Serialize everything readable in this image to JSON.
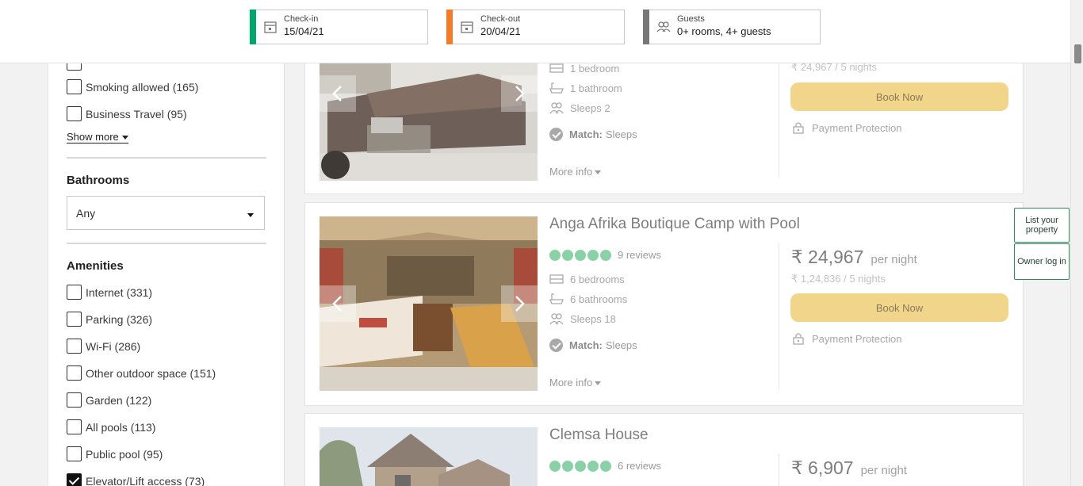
{
  "search": {
    "checkin": {
      "label": "Check-in",
      "value": "15/04/21",
      "accent": "#00a66a"
    },
    "checkout": {
      "label": "Check-out",
      "value": "20/04/21",
      "accent": "#f57c26"
    },
    "guests": {
      "label": "Guests",
      "value": "0+ rooms, 4+ guests",
      "accent": "#777777"
    }
  },
  "filters": {
    "top_items": [
      {
        "label": "Smoking allowed (165)",
        "checked": false
      },
      {
        "label": "Business Travel (95)",
        "checked": false
      }
    ],
    "show_more": "Show more",
    "bathrooms": {
      "title": "Bathrooms",
      "selected": "Any"
    },
    "amenities": {
      "title": "Amenities",
      "items": [
        {
          "label": "Internet (331)",
          "checked": false
        },
        {
          "label": "Parking (326)",
          "checked": false
        },
        {
          "label": "Wi-Fi (286)",
          "checked": false
        },
        {
          "label": "Other outdoor space (151)",
          "checked": false
        },
        {
          "label": "Garden (122)",
          "checked": false
        },
        {
          "label": "All pools (113)",
          "checked": false
        },
        {
          "label": "Public pool (95)",
          "checked": false
        },
        {
          "label": "Elevator/Lift access (73)",
          "checked": true
        }
      ]
    }
  },
  "listings": [
    {
      "features": [
        "1 bedroom",
        "1 bathroom",
        "Sleeps 2"
      ],
      "match_label": "Match:",
      "match_value": "Sleeps",
      "more_info": "More info",
      "total": "₹ 24,967 / 5 nights",
      "book": "Book Now",
      "protection": "Payment Protection"
    },
    {
      "title": "Anga Afrika Boutique Camp with Pool",
      "rating": 5,
      "reviews": "9 reviews",
      "features": [
        "6 bedrooms",
        "6 bathrooms",
        "Sleeps 18"
      ],
      "match_label": "Match:",
      "match_value": "Sleeps",
      "more_info": "More info",
      "price": "₹ 24,967",
      "per": "per night",
      "total": "₹ 1,24,836 / 5 nights",
      "book": "Book Now",
      "protection": "Payment Protection"
    },
    {
      "title": "Clemsa House",
      "rating": 5,
      "reviews": "6 reviews",
      "price": "₹ 6,907",
      "per": "per night"
    }
  ],
  "side_buttons": {
    "list_property": "List your property",
    "owner_login": "Owner log in"
  }
}
